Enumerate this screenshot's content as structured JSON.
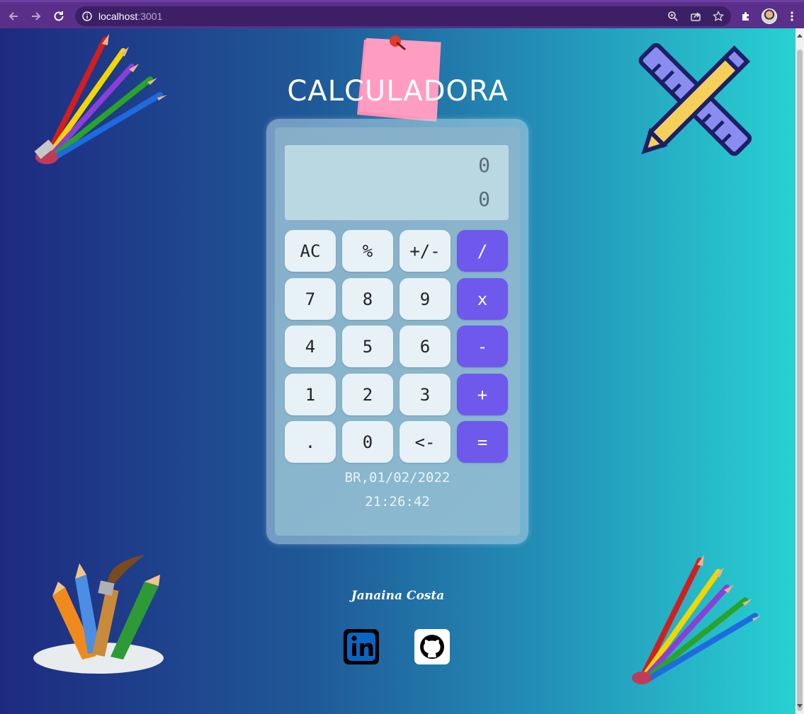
{
  "browser": {
    "url_host": "localhost",
    "url_port": ":3001"
  },
  "page": {
    "title": "CALCULADORA",
    "author": "Janaina Costa"
  },
  "calculator": {
    "previous_operand": "0",
    "current_operand": "0",
    "keys": [
      {
        "label": "AC",
        "kind": "fn"
      },
      {
        "label": "%",
        "kind": "fn"
      },
      {
        "label": "+/-",
        "kind": "fn"
      },
      {
        "label": "/",
        "kind": "op"
      },
      {
        "label": "7",
        "kind": "num"
      },
      {
        "label": "8",
        "kind": "num"
      },
      {
        "label": "9",
        "kind": "num"
      },
      {
        "label": "x",
        "kind": "op"
      },
      {
        "label": "4",
        "kind": "num"
      },
      {
        "label": "5",
        "kind": "num"
      },
      {
        "label": "6",
        "kind": "num"
      },
      {
        "label": "-",
        "kind": "op"
      },
      {
        "label": "1",
        "kind": "num"
      },
      {
        "label": "2",
        "kind": "num"
      },
      {
        "label": "3",
        "kind": "num"
      },
      {
        "label": "+",
        "kind": "op"
      },
      {
        "label": ".",
        "kind": "num"
      },
      {
        "label": "0",
        "kind": "num"
      },
      {
        "label": "<-",
        "kind": "fn"
      },
      {
        "label": "=",
        "kind": "op"
      }
    ],
    "date": "BR,01/02/2022",
    "time": "21:26:42"
  },
  "colors": {
    "operator_key": "#6f58ec",
    "key": "#e8f1f6",
    "display": "#b9d8e2"
  }
}
